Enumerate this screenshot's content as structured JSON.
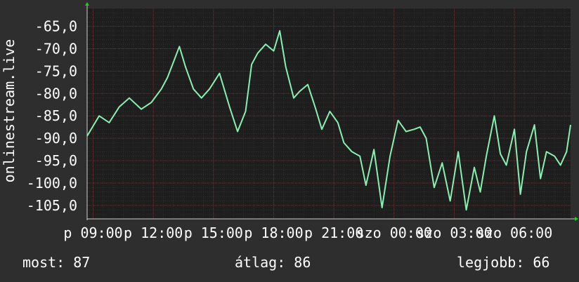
{
  "chart_data": {
    "type": "line",
    "ylabel": "onlinestream.live",
    "ylim": [
      -108,
      -61
    ],
    "y_ticks": [
      -65,
      -70,
      -75,
      -80,
      -85,
      -90,
      -95,
      -100,
      -105
    ],
    "y_tick_labels": [
      "-65,0",
      "-70,0",
      "-75,0",
      "-80,0",
      "-85,0",
      "-90,0",
      "-95,0",
      "-100,0",
      "-105,0"
    ],
    "x_ticks": [
      0,
      3,
      6,
      9,
      12,
      15,
      18,
      21
    ],
    "x_tick_labels": [
      "p 09:00",
      "p 12:00",
      "p 15:00",
      "p 18:00",
      "p 21:00",
      "szo 00:00",
      "szo 03:00",
      "szo 06:00"
    ],
    "xlim": [
      -0.3,
      23.8
    ],
    "grid": true,
    "line_color": "#88f0b0",
    "x_unit": "hours from Friday 09:00",
    "series": [
      {
        "x": [
          -0.3,
          0.3,
          0.8,
          1.3,
          1.8,
          2.4,
          2.9,
          3.4,
          3.7,
          4.0,
          4.3,
          4.6,
          5.0,
          5.4,
          5.8,
          6.3,
          6.8,
          7.2,
          7.6,
          7.9,
          8.2,
          8.6,
          9.0,
          9.3,
          9.6,
          10.0,
          10.3,
          10.7,
          11.1,
          11.4,
          11.8,
          12.2,
          12.5,
          12.9,
          13.3,
          13.6,
          14.0,
          14.4,
          14.8,
          15.2,
          15.6,
          16.0,
          16.3,
          16.6,
          17.0,
          17.4,
          17.8,
          18.2,
          18.6,
          19.0,
          19.3,
          19.6,
          20.0,
          20.3,
          20.6,
          21.0,
          21.3,
          21.6,
          22.0,
          22.3,
          22.6,
          23.0,
          23.3,
          23.6,
          23.8
        ],
        "y": [
          -89.5,
          -85.0,
          -86.5,
          -83.0,
          -81.0,
          -83.5,
          -82.0,
          -79.0,
          -76.5,
          -73.0,
          -69.5,
          -74.0,
          -79.0,
          -81.0,
          -79.0,
          -75.5,
          -83.0,
          -88.5,
          -84.0,
          -73.5,
          -71.0,
          -69.0,
          -70.5,
          -66.0,
          -74.0,
          -81.0,
          -79.5,
          -78.0,
          -83.5,
          -88.0,
          -84.0,
          -86.5,
          -91.0,
          -93.0,
          -94.0,
          -100.5,
          -92.5,
          -105.5,
          -94.0,
          -86.0,
          -88.5,
          -88.0,
          -87.5,
          -90.0,
          -101.0,
          -95.5,
          -104.0,
          -93.0,
          -106.0,
          -96.5,
          -102.0,
          -94.0,
          -85.0,
          -93.5,
          -96.0,
          -88.0,
          -102.5,
          -93.0,
          -87.0,
          -99.0,
          -93.0,
          -94.0,
          -96.0,
          -93.0,
          -87.0
        ]
      }
    ]
  },
  "footer": {
    "now": "most: 87",
    "avg": "átlag: 86",
    "best": "legjobb: 66"
  }
}
